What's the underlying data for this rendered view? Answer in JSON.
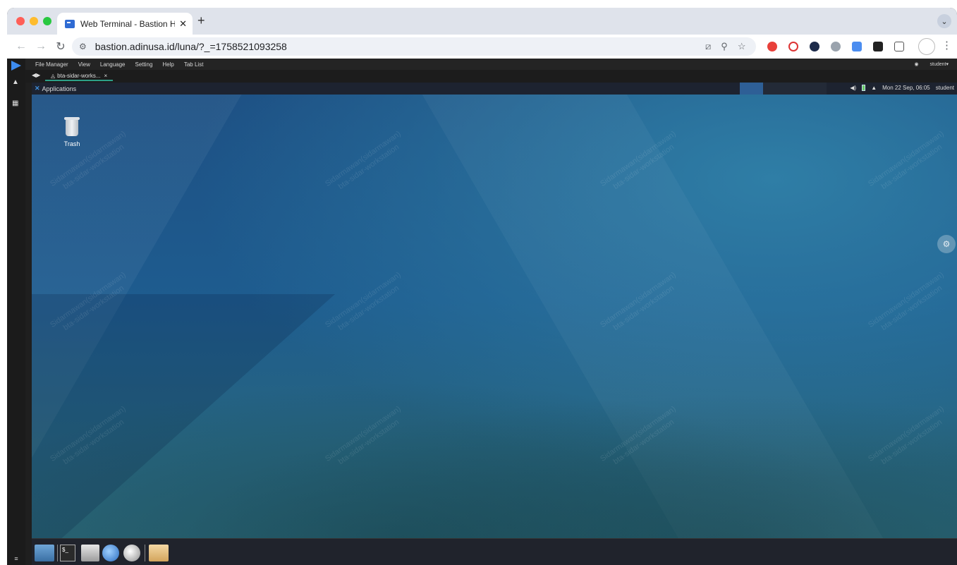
{
  "browser": {
    "tab_title": "Web Terminal - Bastion Host",
    "new_tab": "+",
    "url": "bastion.adinusa.id/luna/?_=1758521093258",
    "traffic_colors": [
      "#ff5f57",
      "#febc2e",
      "#28c840"
    ]
  },
  "luna": {
    "menu": [
      "File Manager",
      "View",
      "Language",
      "Setting",
      "Help",
      "Tab List"
    ],
    "user": "student",
    "session_tab": "bta-sidar-works...",
    "session_close": "×"
  },
  "desktop": {
    "applications_label": "Applications",
    "clock": "Mon 22 Sep, 06:05",
    "panel_user": "student",
    "trash_label": "Trash",
    "terminal_glyph": "$_",
    "watermark_line1": "Sidarmawan(sidarmawan)",
    "watermark_line2": "bta-sidar-workstation"
  },
  "icons": [
    "back-icon",
    "forward-icon",
    "reload-icon",
    "site-settings-icon",
    "bookmark-star-icon",
    "zoom-icon",
    "gear-icon",
    "trash-icon",
    "chevron-down-icon",
    "kebab-menu-icon"
  ]
}
